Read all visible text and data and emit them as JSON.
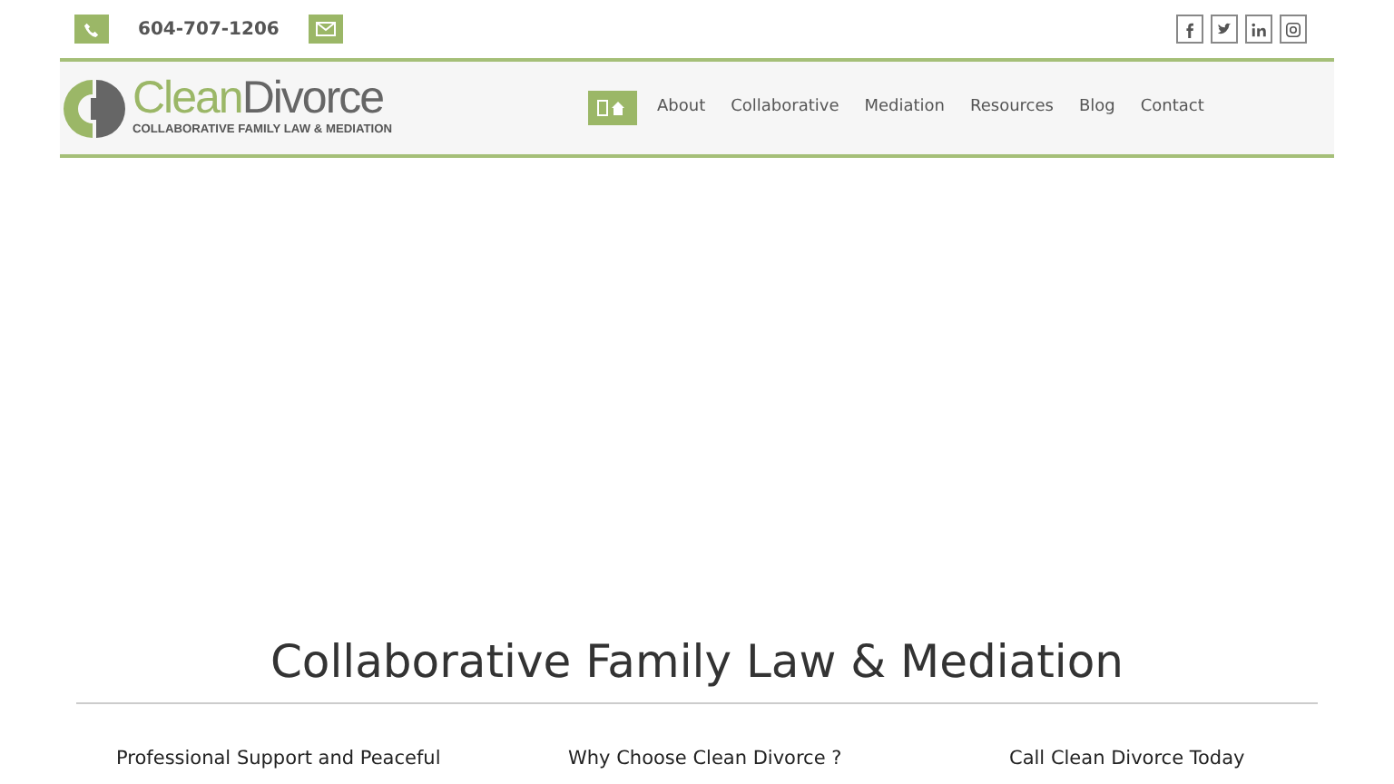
{
  "topbar": {
    "phone": "604-707-1206"
  },
  "logo": {
    "brand_part1": "Clean",
    "brand_part2": "Divorce",
    "tagline": "COLLABORATIVE FAMILY LAW & MEDIATION"
  },
  "nav": [
    {
      "kind": "home",
      "selected": true
    },
    {
      "label": "About",
      "selected": false
    },
    {
      "label": "Collaborative",
      "selected": false
    },
    {
      "label": "Mediation",
      "selected": false
    },
    {
      "label": "Resources",
      "selected": false
    },
    {
      "label": "Blog",
      "selected": false
    },
    {
      "label": "Contact",
      "selected": false
    }
  ],
  "social": [
    {
      "kind": "facebook"
    },
    {
      "kind": "twitter"
    },
    {
      "kind": "linkedin"
    },
    {
      "kind": "instagram"
    }
  ],
  "heading": "Collaborative Family Law & Mediation",
  "columns": [
    "Professional Support and Peaceful",
    "Why Choose Clean Divorce ?",
    "Call Clean Divorce Today"
  ]
}
